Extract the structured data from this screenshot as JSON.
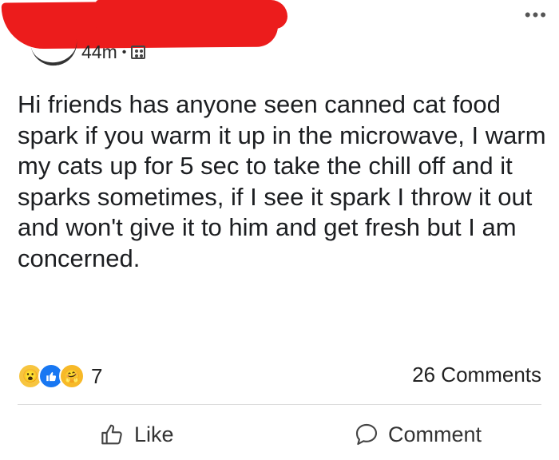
{
  "post": {
    "timestamp": "44m",
    "separator": "•",
    "text": "Hi friends has anyone seen canned cat food spark if you warm it up in the microwave, I warm my cats up for 5 sec to take the chill off and it sparks sometimes, if I see it spark I throw it out and won't give it to him and get fresh but I am concerned."
  },
  "header": {
    "more_label": "•••"
  },
  "reactions": {
    "icons": [
      "wow-reaction-icon",
      "like-reaction-icon",
      "care-reaction-icon"
    ],
    "count": "7"
  },
  "comments": {
    "count_label": "26 Comments"
  },
  "actions": {
    "like_label": "Like",
    "comment_label": "Comment"
  },
  "colors": {
    "redaction": "#ec1c1c",
    "like_blue": "#1877f2"
  }
}
